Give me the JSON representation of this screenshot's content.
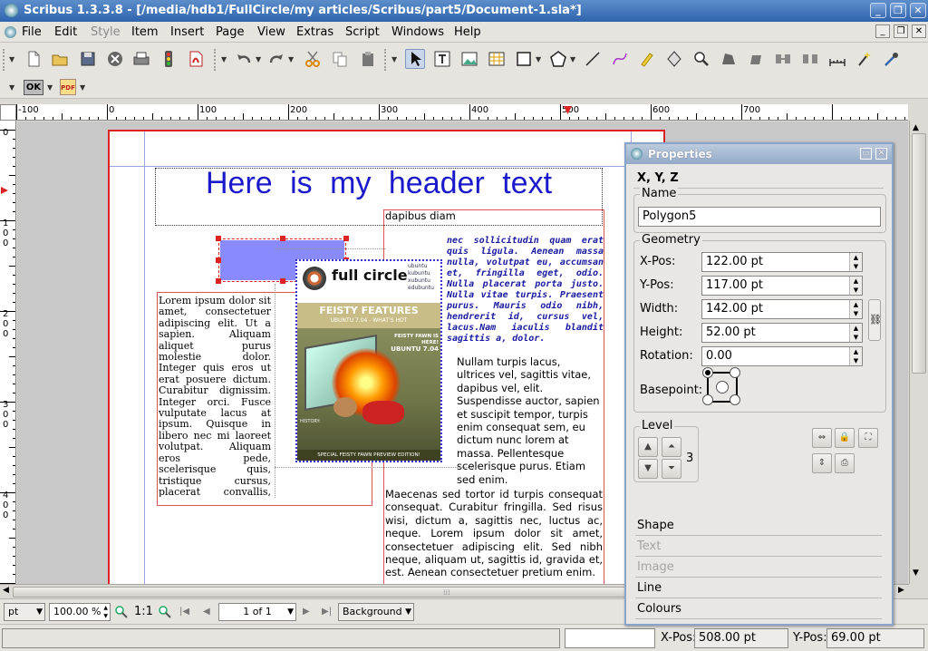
{
  "window": {
    "title": "Scribus 1.3.3.8 - [/media/hdb1/FullCircle/my articles/Scribus/part5/Document-1.sla*]",
    "controls": [
      "_",
      "❐",
      "✕"
    ]
  },
  "menubar": {
    "items": [
      "File",
      "Edit",
      "Style",
      "Item",
      "Insert",
      "Page",
      "View",
      "Extras",
      "Script",
      "Windows",
      "Help"
    ],
    "disabled": [
      "Style"
    ]
  },
  "toolbar2": {
    "ok_label": "OK",
    "pdf_label": "PDF"
  },
  "rulers": {
    "h_labels": [
      "-100",
      "0",
      "100",
      "200",
      "300",
      "400",
      "500",
      "600",
      "700",
      "800"
    ],
    "v_labels": [
      "0",
      "1\n0\n0",
      "2\n0\n0",
      "3\n0\n0",
      "4\n0\n0"
    ]
  },
  "document": {
    "header_text": "Here is my header text",
    "col2_top": "dapibus diam",
    "italic_text": "nec sollicitudin quam erat quis ligula. Aenean massa nulla, volutpat eu, accumsan et, fringilla eget, odio. Nulla placerat porta justo. Nulla vitae turpis. Praesent purus. Mauris odio nibh, hendrerit id, cursus vel, lacus.Nam iaculis blandit sagittis a, dolor.",
    "col1_text": "Lorem ipsum dolor sit amet, consectetuer adipiscing elit. Ut a sapien. Aliquam aliquet purus molestie dolor. Integer quis eros ut erat posuere dictum. Curabitur dignissim. Integer orci. Fusce vulputate lacus at ipsum. Quisque in libero nec mi laoreet volutpat. Aliquam eros pede, scelerisque quis, tristique cursus, placerat convallis, velit. Nam condimentum. Nulla ut mauris. Curabitur adipiscing, mauris non dictum aliquam, arcu risus",
    "col2_wrap": "Nullam turpis lacus, ultrices vel, sagittis vitae, dapibus vel, elit. Suspendisse auctor, sapien et suscipit tempor, turpis enim consequat sem, eu dictum nunc lorem at massa. Pellentesque scelerisque purus. Etiam sed enim.",
    "col2_rest": "Maecenas sed tortor id turpis consequat consequat. Curabitur fringilla. Sed risus wisi, dictum a, sagittis nec, luctus ac, neque. Lorem ipsum dolor sit amet, consectetuer adipiscing elit. Sed nibh neque, aliquam ut, sagittis id, gravida et, est. Aenean consectetuer pretium enim.",
    "magazine": {
      "logo": "full circle",
      "badges": [
        "ubuntu",
        "kubuntu",
        "xubuntu",
        "edubuntu"
      ],
      "banner": "FEISTY FEATURES",
      "subbanner": "UBUNTU 7.04 - WHAT'S HOT",
      "side_head": "FEISTY FAWN IS HERE!",
      "side_sub": "UBUNTU 7.04",
      "history": "HISTORY:",
      "footer": "SPECIAL FEISTY FAWN PREVIEW EDITION!"
    },
    "polygon_color": "#8a8aff"
  },
  "bottombar": {
    "unit": "pt",
    "zoom": "100.00 %",
    "ratio": "1:1",
    "page": "1 of 1",
    "layer": "Background"
  },
  "statusbar": {
    "xpos_label": "X-Pos:",
    "xpos_value": "508.00 pt",
    "ypos_label": "Y-Pos:",
    "ypos_value": "69.00 pt"
  },
  "properties": {
    "title": "Properties",
    "tab_xyz": "X, Y, Z",
    "name_group": "Name",
    "name_value": "Polygon5",
    "geometry_group": "Geometry",
    "xpos_label": "X-Pos:",
    "xpos_value": "122.00 pt",
    "ypos_label": "Y-Pos:",
    "ypos_value": "117.00 pt",
    "width_label": "Width:",
    "width_value": "142.00 pt",
    "height_label": "Height:",
    "height_value": "52.00 pt",
    "rotation_label": "Rotation:",
    "rotation_value": "0.00",
    "basepoint_label": "Basepoint:",
    "level_group": "Level",
    "level_value": "3",
    "sections": [
      "Shape",
      "Text",
      "Image",
      "Line",
      "Colours"
    ],
    "disabled_sections": [
      "Text",
      "Image"
    ]
  }
}
